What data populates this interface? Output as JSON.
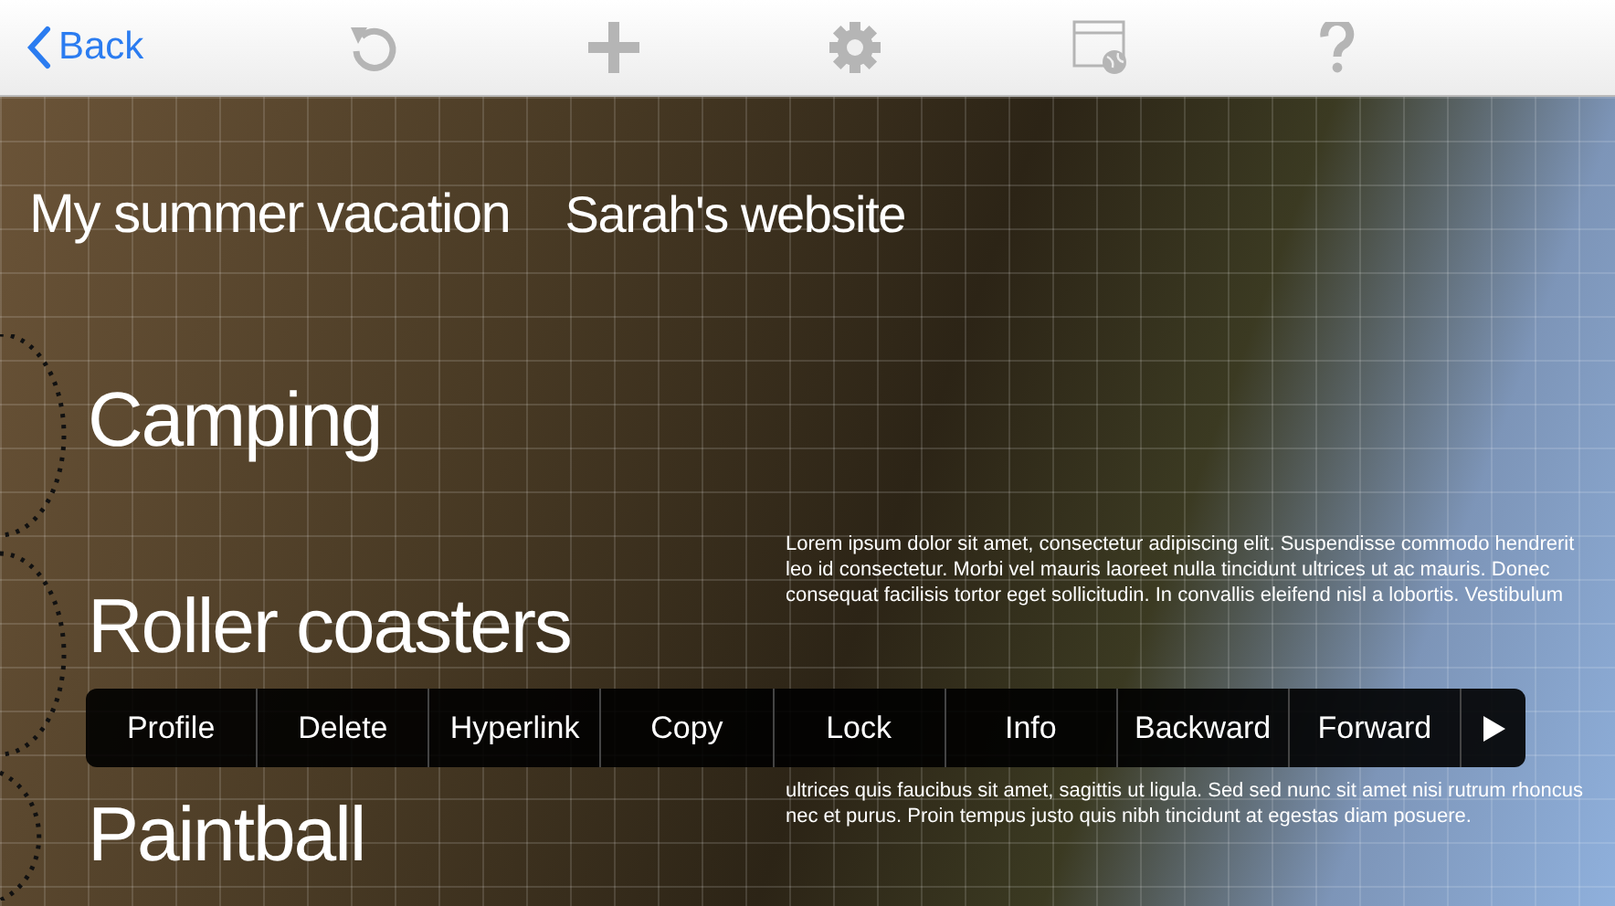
{
  "toolbar": {
    "back_label": "Back"
  },
  "site_header": {
    "title": "My summer vacation",
    "subtitle": "Sarah's website"
  },
  "headings": [
    "Camping",
    "Roller coasters",
    "Paintball"
  ],
  "paragraphs": [
    "Lorem ipsum dolor sit amet, consectetur adipiscing elit. Suspendisse commodo hendrerit leo id consectetur. Morbi vel mauris laoreet nulla tincidunt ultrices ut ac mauris. Donec consequat facilisis tortor eget sollicitudin. In convallis eleifend nisl a lobortis. Vestibulum",
    "ultrices quis faucibus sit amet, sagittis ut ligula. Sed sed nunc sit amet nisi rutrum rhoncus nec et purus. Proin tempus justo quis nibh tincidunt at egestas diam posuere."
  ],
  "context_menu": [
    "Profile",
    "Delete",
    "Hyperlink",
    "Copy",
    "Lock",
    "Info",
    "Backward",
    "Forward"
  ]
}
